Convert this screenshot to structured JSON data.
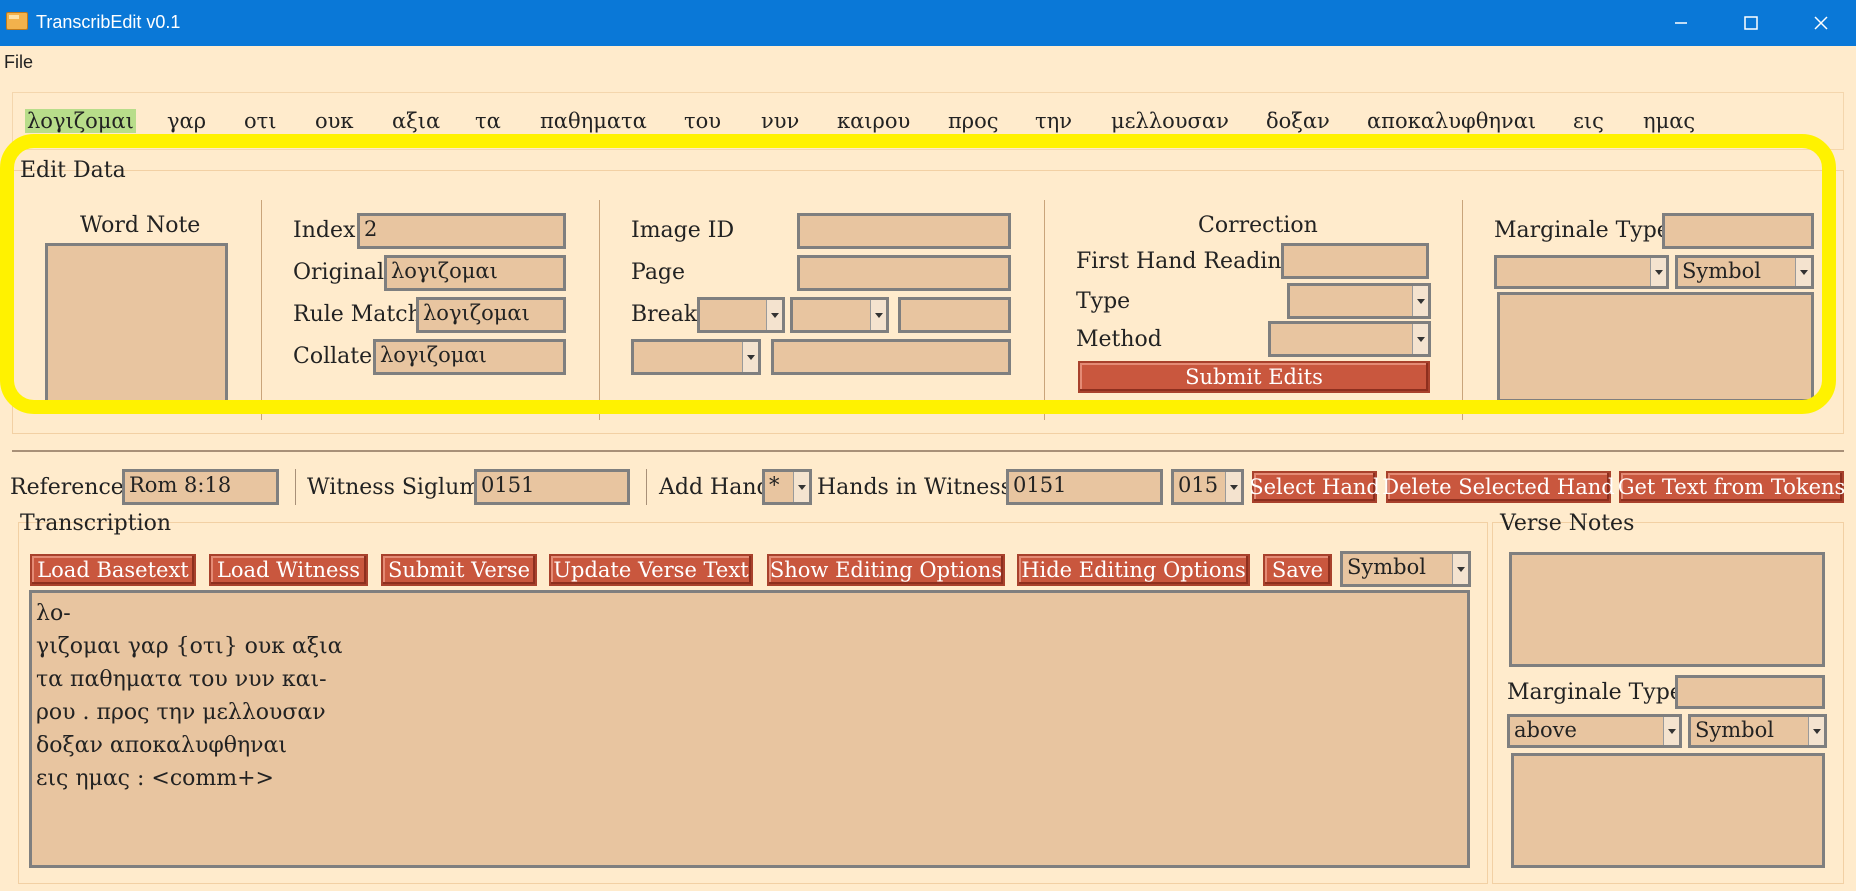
{
  "window": {
    "title": "TranscribEdit   v0.1",
    "app_icon": "folder-icon",
    "controls": [
      "minimize-icon",
      "maximize-icon",
      "close-icon"
    ]
  },
  "menu": {
    "file_label": "File"
  },
  "tokens": [
    {
      "text": "λογιζομαι",
      "selected": true
    },
    {
      "text": "γαρ"
    },
    {
      "text": "οτι"
    },
    {
      "text": "ουκ"
    },
    {
      "text": "αξια"
    },
    {
      "text": "τα"
    },
    {
      "text": "παθηματα"
    },
    {
      "text": "του"
    },
    {
      "text": "νυν"
    },
    {
      "text": "καιρου"
    },
    {
      "text": "προς"
    },
    {
      "text": "την"
    },
    {
      "text": "μελλουσαν"
    },
    {
      "text": "δοξαν"
    },
    {
      "text": "αποκαλυφθηναι"
    },
    {
      "text": "εις"
    },
    {
      "text": "ημας"
    }
  ],
  "edit_data": {
    "legend": "Edit Data",
    "word_note_label": "Word Note",
    "index_label": "Index",
    "index_value": "2",
    "original_label": "Original",
    "original_value": "λογιζομαι",
    "rule_match_label": "Rule Match",
    "rule_match_value": "λογιζομαι",
    "collate_label": "Collate",
    "collate_value": "λογιζομαι",
    "image_id_label": "Image ID",
    "image_id_value": "",
    "page_label": "Page",
    "page_value": "",
    "break_label": "Break",
    "correction_label": "Correction",
    "first_hand_label": "First Hand Reading",
    "type_label": "Type",
    "method_label": "Method",
    "submit_label": "Submit Edits",
    "marginale_type_label": "Marginale Type",
    "marginale_symbol": "Symbol"
  },
  "verse_bar": {
    "reference_label": "Reference",
    "reference_value": "Rom 8:18",
    "witness_label": "Witness Siglum",
    "witness_value": "0151",
    "add_hand_label": "Add Hand",
    "add_hand_value": "*",
    "hands_label": "Hands in Witness:",
    "hands_value": "0151",
    "hands_select": "015",
    "select_hand_label": "Select Hand",
    "delete_hand_label": "Delete Selected Hand",
    "get_text_label": "Get Text from Tokens"
  },
  "transcription": {
    "legend": "Transcription",
    "buttons": [
      "Load Basetext",
      "Load Witness",
      "Submit Verse",
      "Update Verse Text",
      "Show Editing Options",
      "Hide Editing Options",
      "Save"
    ],
    "symbol_select": "Symbol",
    "lines": [
      "λο-",
      "γιζομαι γαρ {οτι} ουκ αξια",
      "τα παθηματα του νυν και-",
      "ρου . προς την μελλουσαν",
      "δοξαν αποκαλυφθηναι",
      "εις ημας : <comm+>"
    ]
  },
  "verse_notes": {
    "legend": "Verse Notes",
    "marginale_type_label": "Marginale Type",
    "position_select": "above",
    "symbol_select": "Symbol"
  },
  "colors": {
    "background": "#ffebcc",
    "titlebar": "#0a78d7",
    "field": "#e8c5a0",
    "button": "#c9573e",
    "token_selected": "#b8dd8a",
    "highlight": "#fff200"
  }
}
